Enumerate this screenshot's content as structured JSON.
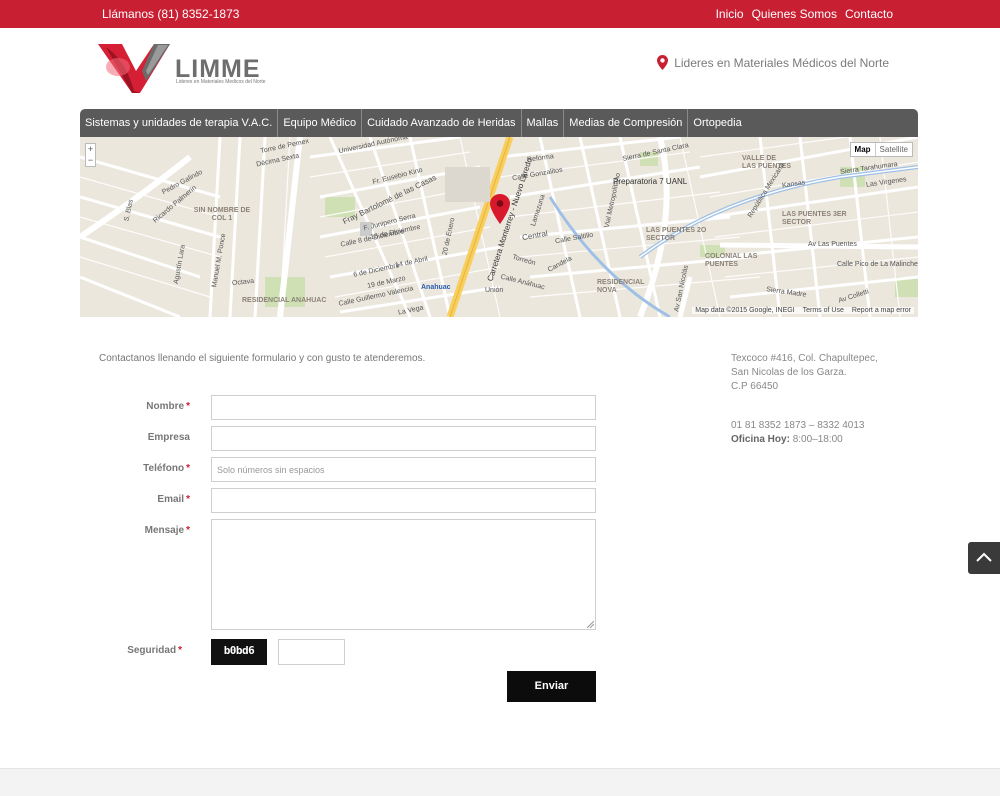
{
  "topbar": {
    "phone": "Llámanos (81) 8352-1873",
    "links": [
      "Inicio",
      "Quienes Somos",
      "Contacto"
    ]
  },
  "header": {
    "logo_text": "LIMME",
    "logo_sub": "Lideres en Materiales Medicos del Norte",
    "tagline": "Lideres en Materiales Médicos del Norte"
  },
  "nav": {
    "items": [
      "Sistemas y unidades de terapia V.A.C.",
      "Equipo Médico",
      "Cuidado Avanzado de Heridas",
      "Mallas",
      "Medias de Compresión",
      "Ortopedia"
    ]
  },
  "map": {
    "zoom_in": "+",
    "zoom_out": "−",
    "type_map": "Map",
    "type_satellite": "Satellite",
    "attribution": "Map data ©2015 Google, INEGI",
    "terms": "Terms of Use",
    "report": "Report a map error",
    "labels": {
      "universidad": "Universidad Autónoma",
      "pedro_galindo": "Pedro Galindo",
      "ricardo_palmerin": "Ricardo Palmerín",
      "s_blas": "S. Blas",
      "decima": "Décima Sexta",
      "torre": "Torre de Pemex",
      "fr_eusebio": "Fr. Eusebio Kino",
      "fray_bartolome": "Fray Bartolomé de las Casas",
      "sin_nombre": "SIN NOMBRE DE COL 1",
      "fr_junipero": "F. Junipero Serra",
      "calle_8": "Calle 8 de Diciembre",
      "18_dic": "18 de Diciembre",
      "20_enero": "20 de Enero",
      "14_abril": "14 de Abril",
      "6_dic": "6 de Diciembre",
      "19_marzo": "19 de Marzo",
      "guillermo": "Calle Guillermo Valencia",
      "residencial_anahuac": "RESIDENCIAL ANAHUAC",
      "manuel_ponce": "Manuel M. Ponce",
      "agustin_lara": "Agustín Lara",
      "octava": "Octava",
      "anahuac": "Anahuac",
      "la_vega": "La Vega",
      "carretera": "Carretera Monterrey - Nuevo Laredo",
      "reforma": "Reforma",
      "calle_gonzalitos": "Calle Gonzalitos",
      "vial_metropolitano": "Vial Metropolitano",
      "central": "Central",
      "calle_saltillo": "Calle Saltillo",
      "torreon": "Torreón",
      "candela": "Candela",
      "calle_anahuac": "Calle Anáhuac",
      "union": "Unión",
      "prepa": "Preparatoria 7 UANL",
      "sierra_santa_clara": "Sierra de Santa Clara",
      "valle_puentes": "VALLE DE LAS PUENTES",
      "republica_mexicana": "República Mexicana",
      "sierra_tarahumara": "Sierra Tarahumara",
      "las_virgenes": "Las Virgenes",
      "kansas": "Kansas",
      "puentes_3er": "LAS PUENTES 3ER SECTOR",
      "puentes_2o": "LAS PUENTES 2O SECTOR",
      "av_las_puentes": "Av Las Puentes",
      "colonial_puentes": "COLONIAL LAS PUENTES",
      "calle_pico": "Calle Pico de La Malinche",
      "residencial_nova": "RESIDENCIAL NOVA",
      "av_san_nicolas": "Av San Nicolás",
      "av_colletti": "Av Colletti",
      "sierra_madre": "Sierra Madre",
      "lamarta": "Lamazuna"
    }
  },
  "contact": {
    "intro": "Contactanos llenando el siguiente formulario y con gusto te atenderemos.",
    "address_lines": [
      "Texcoco #416, Col. Chapultepec,",
      "San Nicolas de los Garza.",
      "C.P 66450"
    ],
    "phones": "01 81 8352 1873 – 8332 4013",
    "hours_label": "Oficina Hoy:",
    "hours_value": "8:00–18:00"
  },
  "form": {
    "nombre_label": "Nombre",
    "empresa_label": "Empresa",
    "telefono_label": "Teléfono",
    "telefono_placeholder": "Solo números sin espacios",
    "email_label": "Email",
    "mensaje_label": "Mensaje",
    "seguridad_label": "Seguridad",
    "captcha_code": "b0bd6",
    "required_mark": "*",
    "submit_label": "Enviar"
  },
  "colors": {
    "brand_red": "#c81f33",
    "nav_gray": "#5a5a5a",
    "button_black": "#0c0c0c"
  },
  "icons": {
    "location_pin": "map-pin-icon",
    "back_to_top": "chevron-up-icon",
    "map_marker": "map-marker-icon"
  }
}
